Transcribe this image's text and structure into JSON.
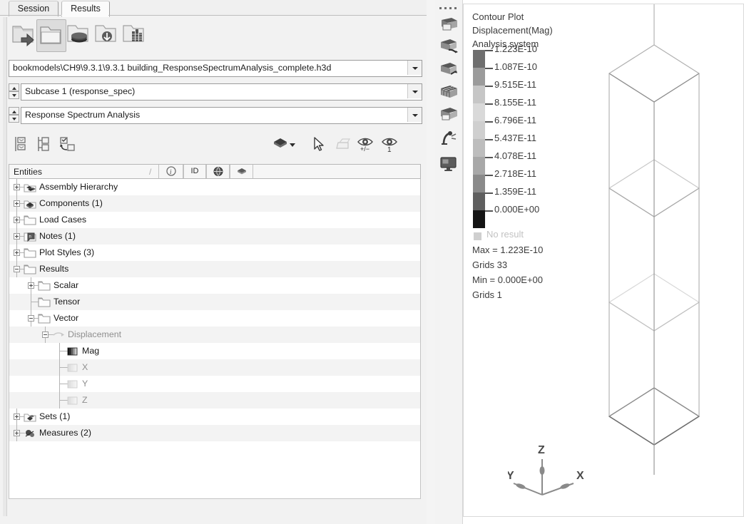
{
  "tabs": [
    {
      "label": "Session",
      "active": false,
      "name": "tab-session"
    },
    {
      "label": "Results",
      "active": true,
      "name": "tab-results"
    }
  ],
  "folder_toolbar": [
    {
      "name": "load-model-button",
      "icon": "folder-open-arrow-icon"
    },
    {
      "name": "open-folder-button",
      "icon": "folder-icon"
    },
    {
      "name": "folder-database-button",
      "icon": "folder-database-icon"
    },
    {
      "name": "folder-import-button",
      "icon": "folder-download-icon"
    },
    {
      "name": "folder-model-button",
      "icon": "folder-building-icon"
    }
  ],
  "selectors": {
    "file": {
      "value": "bookmodels\\CH9\\9.3.1\\9.3.1 building_ResponseSpectrumAnalysis_complete.h3d",
      "name": "model-file-select"
    },
    "subcase": {
      "value": "Subcase 1 (response_spec)",
      "name": "subcase-select"
    },
    "analysis": {
      "value": "Response Spectrum Analysis",
      "name": "analysis-type-select"
    }
  },
  "tools2": [
    {
      "name": "expand-all-button",
      "icon": "expand-tree-icon"
    },
    {
      "name": "collapse-all-button",
      "icon": "collapse-tree-icon"
    },
    {
      "name": "sync-selection-button",
      "icon": "sync-tree-icon"
    },
    {
      "name": "display-mode-button",
      "icon": "shaded-cube-icon"
    },
    {
      "name": "display-mode-dropdown",
      "icon": "chevron-down-icon"
    },
    {
      "name": "pointer-tool-button",
      "icon": "arrow-cursor-icon"
    },
    {
      "name": "isolate-button",
      "icon": "isolate-icon"
    },
    {
      "name": "show-hide-button",
      "icon": "eye-plus-minus-icon"
    },
    {
      "name": "show-only-button",
      "icon": "eye-one-icon"
    }
  ],
  "entities_header": {
    "title": "Entities",
    "sort_marker": "/",
    "columns": [
      {
        "label": "",
        "icon": "info-icon",
        "name": "column-info"
      },
      {
        "label": "ID",
        "icon": "",
        "name": "column-id"
      },
      {
        "label": "",
        "icon": "globe-icon",
        "name": "column-color"
      },
      {
        "label": "",
        "icon": "cube-icon",
        "name": "column-display"
      }
    ]
  },
  "tree": [
    {
      "label": "Assembly Hierarchy",
      "depth": 0,
      "toggle": "plus",
      "icon": "assembly-icon",
      "selected": false,
      "dim": false
    },
    {
      "label": "Components (1)",
      "depth": 0,
      "toggle": "plus",
      "icon": "components-icon",
      "selected": false,
      "dim": false
    },
    {
      "label": "Load Cases",
      "depth": 0,
      "toggle": "plus",
      "icon": "folder-icon",
      "selected": false,
      "dim": false
    },
    {
      "label": "Notes (1)",
      "depth": 0,
      "toggle": "plus",
      "icon": "notes-icon",
      "selected": false,
      "dim": false
    },
    {
      "label": "Plot Styles (3)",
      "depth": 0,
      "toggle": "plus",
      "icon": "folder-icon",
      "selected": false,
      "dim": false
    },
    {
      "label": "Results",
      "depth": 0,
      "toggle": "minus",
      "icon": "folder-icon",
      "selected": false,
      "dim": false
    },
    {
      "label": "Scalar",
      "depth": 1,
      "toggle": "plus",
      "icon": "folder-icon",
      "selected": false,
      "dim": false
    },
    {
      "label": "Tensor",
      "depth": 1,
      "toggle": "none",
      "icon": "folder-icon",
      "selected": false,
      "dim": false
    },
    {
      "label": "Vector",
      "depth": 1,
      "toggle": "minus",
      "icon": "folder-icon",
      "selected": false,
      "dim": false
    },
    {
      "label": "Displacement",
      "depth": 2,
      "toggle": "minus",
      "icon": "vector-icon",
      "selected": false,
      "dim": true
    },
    {
      "label": "Mag",
      "depth": 3,
      "toggle": "none",
      "icon": "contour-bars-icon",
      "selected": true,
      "dim": false
    },
    {
      "label": "X",
      "depth": 3,
      "toggle": "none",
      "icon": "contour-bars-icon",
      "selected": false,
      "dim": true
    },
    {
      "label": "Y",
      "depth": 3,
      "toggle": "none",
      "icon": "contour-bars-icon",
      "selected": false,
      "dim": true
    },
    {
      "label": "Z",
      "depth": 3,
      "toggle": "none",
      "icon": "contour-bars-icon",
      "selected": false,
      "dim": true
    },
    {
      "label": "Sets  (1)",
      "depth": 0,
      "toggle": "plus",
      "icon": "sets-icon",
      "selected": false,
      "dim": false
    },
    {
      "label": "Measures (2)",
      "depth": 0,
      "toggle": "plus",
      "icon": "measures-icon",
      "selected": false,
      "dim": false
    }
  ],
  "vertical_toolbar": [
    {
      "name": "contour-panel-button",
      "icon": "contour-panel-icon"
    },
    {
      "name": "iso-panel-button",
      "icon": "iso-surface-icon"
    },
    {
      "name": "vector-panel-button",
      "icon": "vector-plot-icon"
    },
    {
      "name": "section-cut-button",
      "icon": "section-cut-icon"
    },
    {
      "name": "deformed-panel-button",
      "icon": "deformed-shape-icon"
    },
    {
      "name": "tracing-panel-button",
      "icon": "tracing-icon"
    },
    {
      "name": "display-panel-button",
      "icon": "monitor-icon"
    }
  ],
  "legend": {
    "title_lines": [
      "Contour Plot",
      "Displacement(Mag)",
      "Analysis system"
    ],
    "no_result_label": "No result",
    "ticks": [
      "1.223E-10",
      "1.087E-10",
      "9.515E-11",
      "8.155E-11",
      "6.796E-11",
      "5.437E-11",
      "4.078E-11",
      "2.718E-11",
      "1.359E-11",
      "0.000E+00"
    ],
    "swatch_colors": [
      "#6e6e6e",
      "#9b9b9b",
      "#c6c6c6",
      "#d9d9d9",
      "#cfcfcf",
      "#bdbdbd",
      "#a8a8a8",
      "#8a8a8a",
      "#5f5f5f",
      "#141414"
    ],
    "info": [
      "Max = 1.223E-10",
      "Grids 33",
      "Min = 0.000E+00",
      "Grids 1"
    ]
  },
  "axis_triad": {
    "z_label": "Z",
    "x_label": "X",
    "y_label": "Y"
  },
  "colors": {
    "panel_bg": "#f2f2f2",
    "tree_bg": "#ffffff",
    "tree_alt_row": "#f3f3f3",
    "border": "#b7b7b7",
    "text": "#1a1a1a",
    "legend_text": "#3c3c3c",
    "model_line": "#9a9a9a"
  }
}
